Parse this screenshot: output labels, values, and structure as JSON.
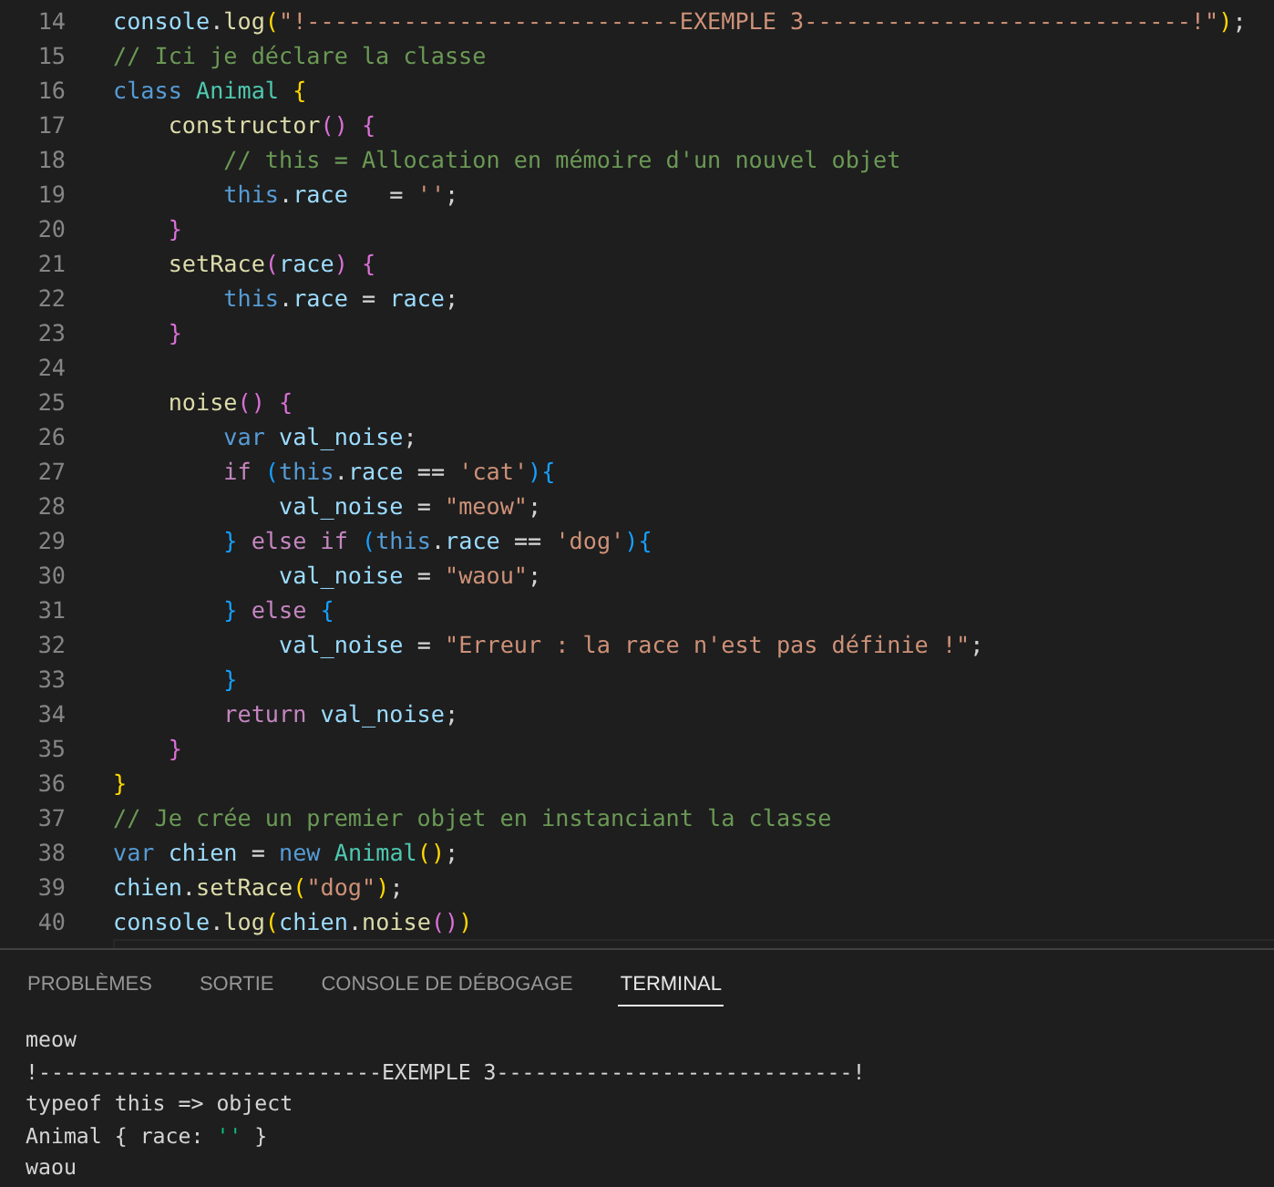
{
  "editor": {
    "lines": [
      {
        "number": "14",
        "tokens": [
          {
            "text": "console",
            "kind": "variable"
          },
          {
            "text": ".",
            "kind": "plain"
          },
          {
            "text": "log",
            "kind": "function"
          },
          {
            "text": "(",
            "kind": "bracket1"
          },
          {
            "text": "\"!---------------------------EXEMPLE 3----------------------------!\"",
            "kind": "string"
          },
          {
            "text": ")",
            "kind": "bracket1"
          },
          {
            "text": ";",
            "kind": "plain"
          }
        ]
      },
      {
        "number": "15",
        "tokens": [
          {
            "text": "// Ici je déclare la classe",
            "kind": "comment"
          }
        ]
      },
      {
        "number": "16",
        "tokens": [
          {
            "text": "class ",
            "kind": "keyword"
          },
          {
            "text": "Animal ",
            "kind": "type"
          },
          {
            "text": "{",
            "kind": "bracket1"
          }
        ]
      },
      {
        "number": "17",
        "tokens": [
          {
            "text": "    constructor",
            "kind": "function"
          },
          {
            "text": "() {",
            "kind": "bracket2"
          }
        ]
      },
      {
        "number": "18",
        "tokens": [
          {
            "text": "        // this = Allocation en mémoire d'un nouvel objet",
            "kind": "comment"
          }
        ]
      },
      {
        "number": "19",
        "tokens": [
          {
            "text": "        this",
            "kind": "keyword"
          },
          {
            "text": ".",
            "kind": "plain"
          },
          {
            "text": "race",
            "kind": "variable"
          },
          {
            "text": "   = ",
            "kind": "plain"
          },
          {
            "text": "''",
            "kind": "string"
          },
          {
            "text": ";",
            "kind": "plain"
          }
        ]
      },
      {
        "number": "20",
        "tokens": [
          {
            "text": "    }",
            "kind": "bracket2"
          }
        ]
      },
      {
        "number": "21",
        "tokens": [
          {
            "text": "    setRace",
            "kind": "function"
          },
          {
            "text": "(",
            "kind": "bracket2"
          },
          {
            "text": "race",
            "kind": "variable"
          },
          {
            "text": ") {",
            "kind": "bracket2"
          }
        ]
      },
      {
        "number": "22",
        "tokens": [
          {
            "text": "        this",
            "kind": "keyword"
          },
          {
            "text": ".",
            "kind": "plain"
          },
          {
            "text": "race",
            "kind": "variable"
          },
          {
            "text": " = ",
            "kind": "plain"
          },
          {
            "text": "race",
            "kind": "variable"
          },
          {
            "text": ";",
            "kind": "plain"
          }
        ]
      },
      {
        "number": "23",
        "tokens": [
          {
            "text": "    }",
            "kind": "bracket2"
          }
        ]
      },
      {
        "number": "24"
      },
      {
        "number": "25",
        "tokens": [
          {
            "text": "    noise",
            "kind": "function"
          },
          {
            "text": "() {",
            "kind": "bracket2"
          }
        ]
      },
      {
        "number": "26",
        "tokens": [
          {
            "text": "        var ",
            "kind": "keyword"
          },
          {
            "text": "val_noise",
            "kind": "variable"
          },
          {
            "text": ";",
            "kind": "plain"
          }
        ]
      },
      {
        "number": "27",
        "tokens": [
          {
            "text": "        if ",
            "kind": "control"
          },
          {
            "text": "(",
            "kind": "bracket3"
          },
          {
            "text": "this",
            "kind": "keyword"
          },
          {
            "text": ".",
            "kind": "plain"
          },
          {
            "text": "race",
            "kind": "variable"
          },
          {
            "text": " == ",
            "kind": "plain"
          },
          {
            "text": "'cat'",
            "kind": "string"
          },
          {
            "text": "){",
            "kind": "bracket3"
          }
        ]
      },
      {
        "number": "28",
        "tokens": [
          {
            "text": "            val_noise",
            "kind": "variable"
          },
          {
            "text": " = ",
            "kind": "plain"
          },
          {
            "text": "\"meow\"",
            "kind": "string"
          },
          {
            "text": ";",
            "kind": "plain"
          }
        ]
      },
      {
        "number": "29",
        "tokens": [
          {
            "text": "        } ",
            "kind": "bracket3"
          },
          {
            "text": "else if ",
            "kind": "control"
          },
          {
            "text": "(",
            "kind": "bracket3"
          },
          {
            "text": "this",
            "kind": "keyword"
          },
          {
            "text": ".",
            "kind": "plain"
          },
          {
            "text": "race",
            "kind": "variable"
          },
          {
            "text": " == ",
            "kind": "plain"
          },
          {
            "text": "'dog'",
            "kind": "string"
          },
          {
            "text": "){",
            "kind": "bracket3"
          }
        ]
      },
      {
        "number": "30",
        "tokens": [
          {
            "text": "            val_noise",
            "kind": "variable"
          },
          {
            "text": " = ",
            "kind": "plain"
          },
          {
            "text": "\"waou\"",
            "kind": "string"
          },
          {
            "text": ";",
            "kind": "plain"
          }
        ]
      },
      {
        "number": "31",
        "tokens": [
          {
            "text": "        } ",
            "kind": "bracket3"
          },
          {
            "text": "else ",
            "kind": "control"
          },
          {
            "text": "{",
            "kind": "bracket3"
          }
        ]
      },
      {
        "number": "32",
        "tokens": [
          {
            "text": "            val_noise",
            "kind": "variable"
          },
          {
            "text": " = ",
            "kind": "plain"
          },
          {
            "text": "\"Erreur : la race n'est pas définie !\"",
            "kind": "string"
          },
          {
            "text": ";",
            "kind": "plain"
          }
        ]
      },
      {
        "number": "33",
        "tokens": [
          {
            "text": "        }",
            "kind": "bracket3"
          }
        ]
      },
      {
        "number": "34",
        "tokens": [
          {
            "text": "        return ",
            "kind": "control"
          },
          {
            "text": "val_noise",
            "kind": "variable"
          },
          {
            "text": ";",
            "kind": "plain"
          }
        ]
      },
      {
        "number": "35",
        "tokens": [
          {
            "text": "    }",
            "kind": "bracket2"
          }
        ]
      },
      {
        "number": "36",
        "tokens": [
          {
            "text": "}",
            "kind": "bracket1"
          }
        ]
      },
      {
        "number": "37",
        "tokens": [
          {
            "text": "// Je crée un premier objet en instanciant la classe",
            "kind": "comment"
          }
        ]
      },
      {
        "number": "38",
        "tokens": [
          {
            "text": "var ",
            "kind": "keyword"
          },
          {
            "text": "chien",
            "kind": "variable"
          },
          {
            "text": " = ",
            "kind": "plain"
          },
          {
            "text": "new ",
            "kind": "keyword"
          },
          {
            "text": "Animal",
            "kind": "type"
          },
          {
            "text": "()",
            "kind": "bracket1"
          },
          {
            "text": ";",
            "kind": "plain"
          }
        ]
      },
      {
        "number": "39",
        "tokens": [
          {
            "text": "chien",
            "kind": "variable"
          },
          {
            "text": ".",
            "kind": "plain"
          },
          {
            "text": "setRace",
            "kind": "function"
          },
          {
            "text": "(",
            "kind": "bracket1"
          },
          {
            "text": "\"dog\"",
            "kind": "string"
          },
          {
            "text": ")",
            "kind": "bracket1"
          },
          {
            "text": ";",
            "kind": "plain"
          }
        ]
      },
      {
        "number": "40",
        "tokens": [
          {
            "text": "console",
            "kind": "variable"
          },
          {
            "text": ".",
            "kind": "plain"
          },
          {
            "text": "log",
            "kind": "function"
          },
          {
            "text": "(",
            "kind": "bracket1"
          },
          {
            "text": "chien",
            "kind": "variable"
          },
          {
            "text": ".",
            "kind": "plain"
          },
          {
            "text": "noise",
            "kind": "function"
          },
          {
            "text": "()",
            "kind": "bracket2"
          },
          {
            "text": ")",
            "kind": "bracket1"
          }
        ]
      }
    ]
  },
  "panel": {
    "tabs": [
      {
        "label": "PROBLÈMES",
        "selected": false
      },
      {
        "label": "SORTIE",
        "selected": false
      },
      {
        "label": "CONSOLE DE DÉBOGAGE",
        "selected": false
      },
      {
        "label": "TERMINAL",
        "selected": true
      }
    ],
    "terminal_lines": [
      {
        "tokens": [
          {
            "text": "meow",
            "kind": "plain"
          }
        ]
      },
      {
        "tokens": [
          {
            "text": "!---------------------------EXEMPLE 3----------------------------!",
            "kind": "plain"
          }
        ]
      },
      {
        "tokens": [
          {
            "text": "typeof this => object",
            "kind": "plain"
          }
        ]
      },
      {
        "tokens": [
          {
            "text": "Animal { race: ",
            "kind": "plain"
          },
          {
            "text": "''",
            "kind": "green"
          },
          {
            "text": " }",
            "kind": "plain"
          }
        ]
      },
      {
        "tokens": [
          {
            "text": "waou",
            "kind": "plain"
          }
        ]
      }
    ]
  }
}
